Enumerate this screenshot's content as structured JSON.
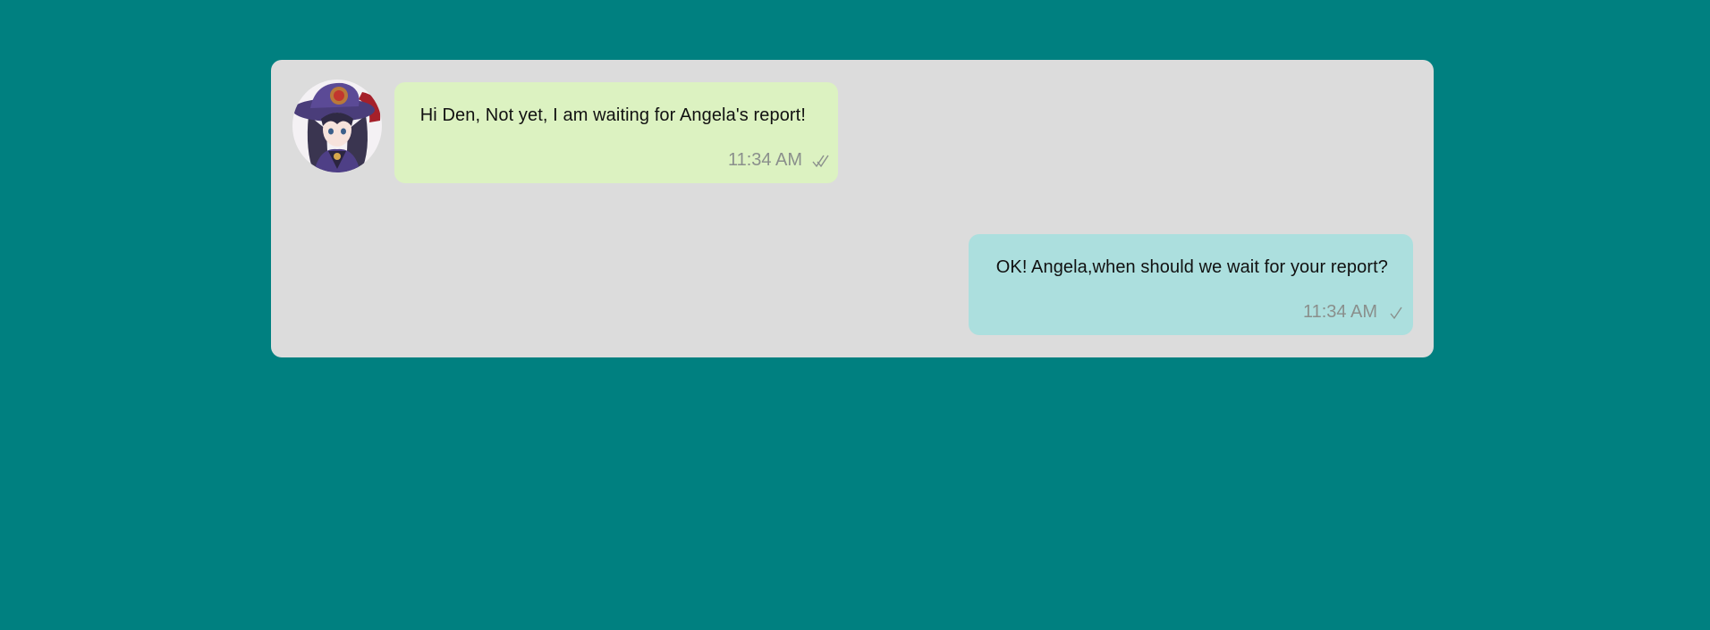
{
  "chat": {
    "messages": [
      {
        "direction": "incoming",
        "text": "Hi Den, Not yet, I am waiting for Angela's report!",
        "time": "11:34 AM",
        "status_icon": "double-check-icon"
      },
      {
        "direction": "outgoing",
        "text": "OK! Angela,when should we wait for your report?",
        "time": "11:34 AM",
        "status_icon": "single-check-icon"
      }
    ]
  },
  "colors": {
    "page_background": "#008080",
    "panel_background": "#dcdcdc",
    "incoming_bubble": "#dcf2c1",
    "outgoing_bubble": "#acdfde",
    "timestamp": "#8a8f8c"
  }
}
